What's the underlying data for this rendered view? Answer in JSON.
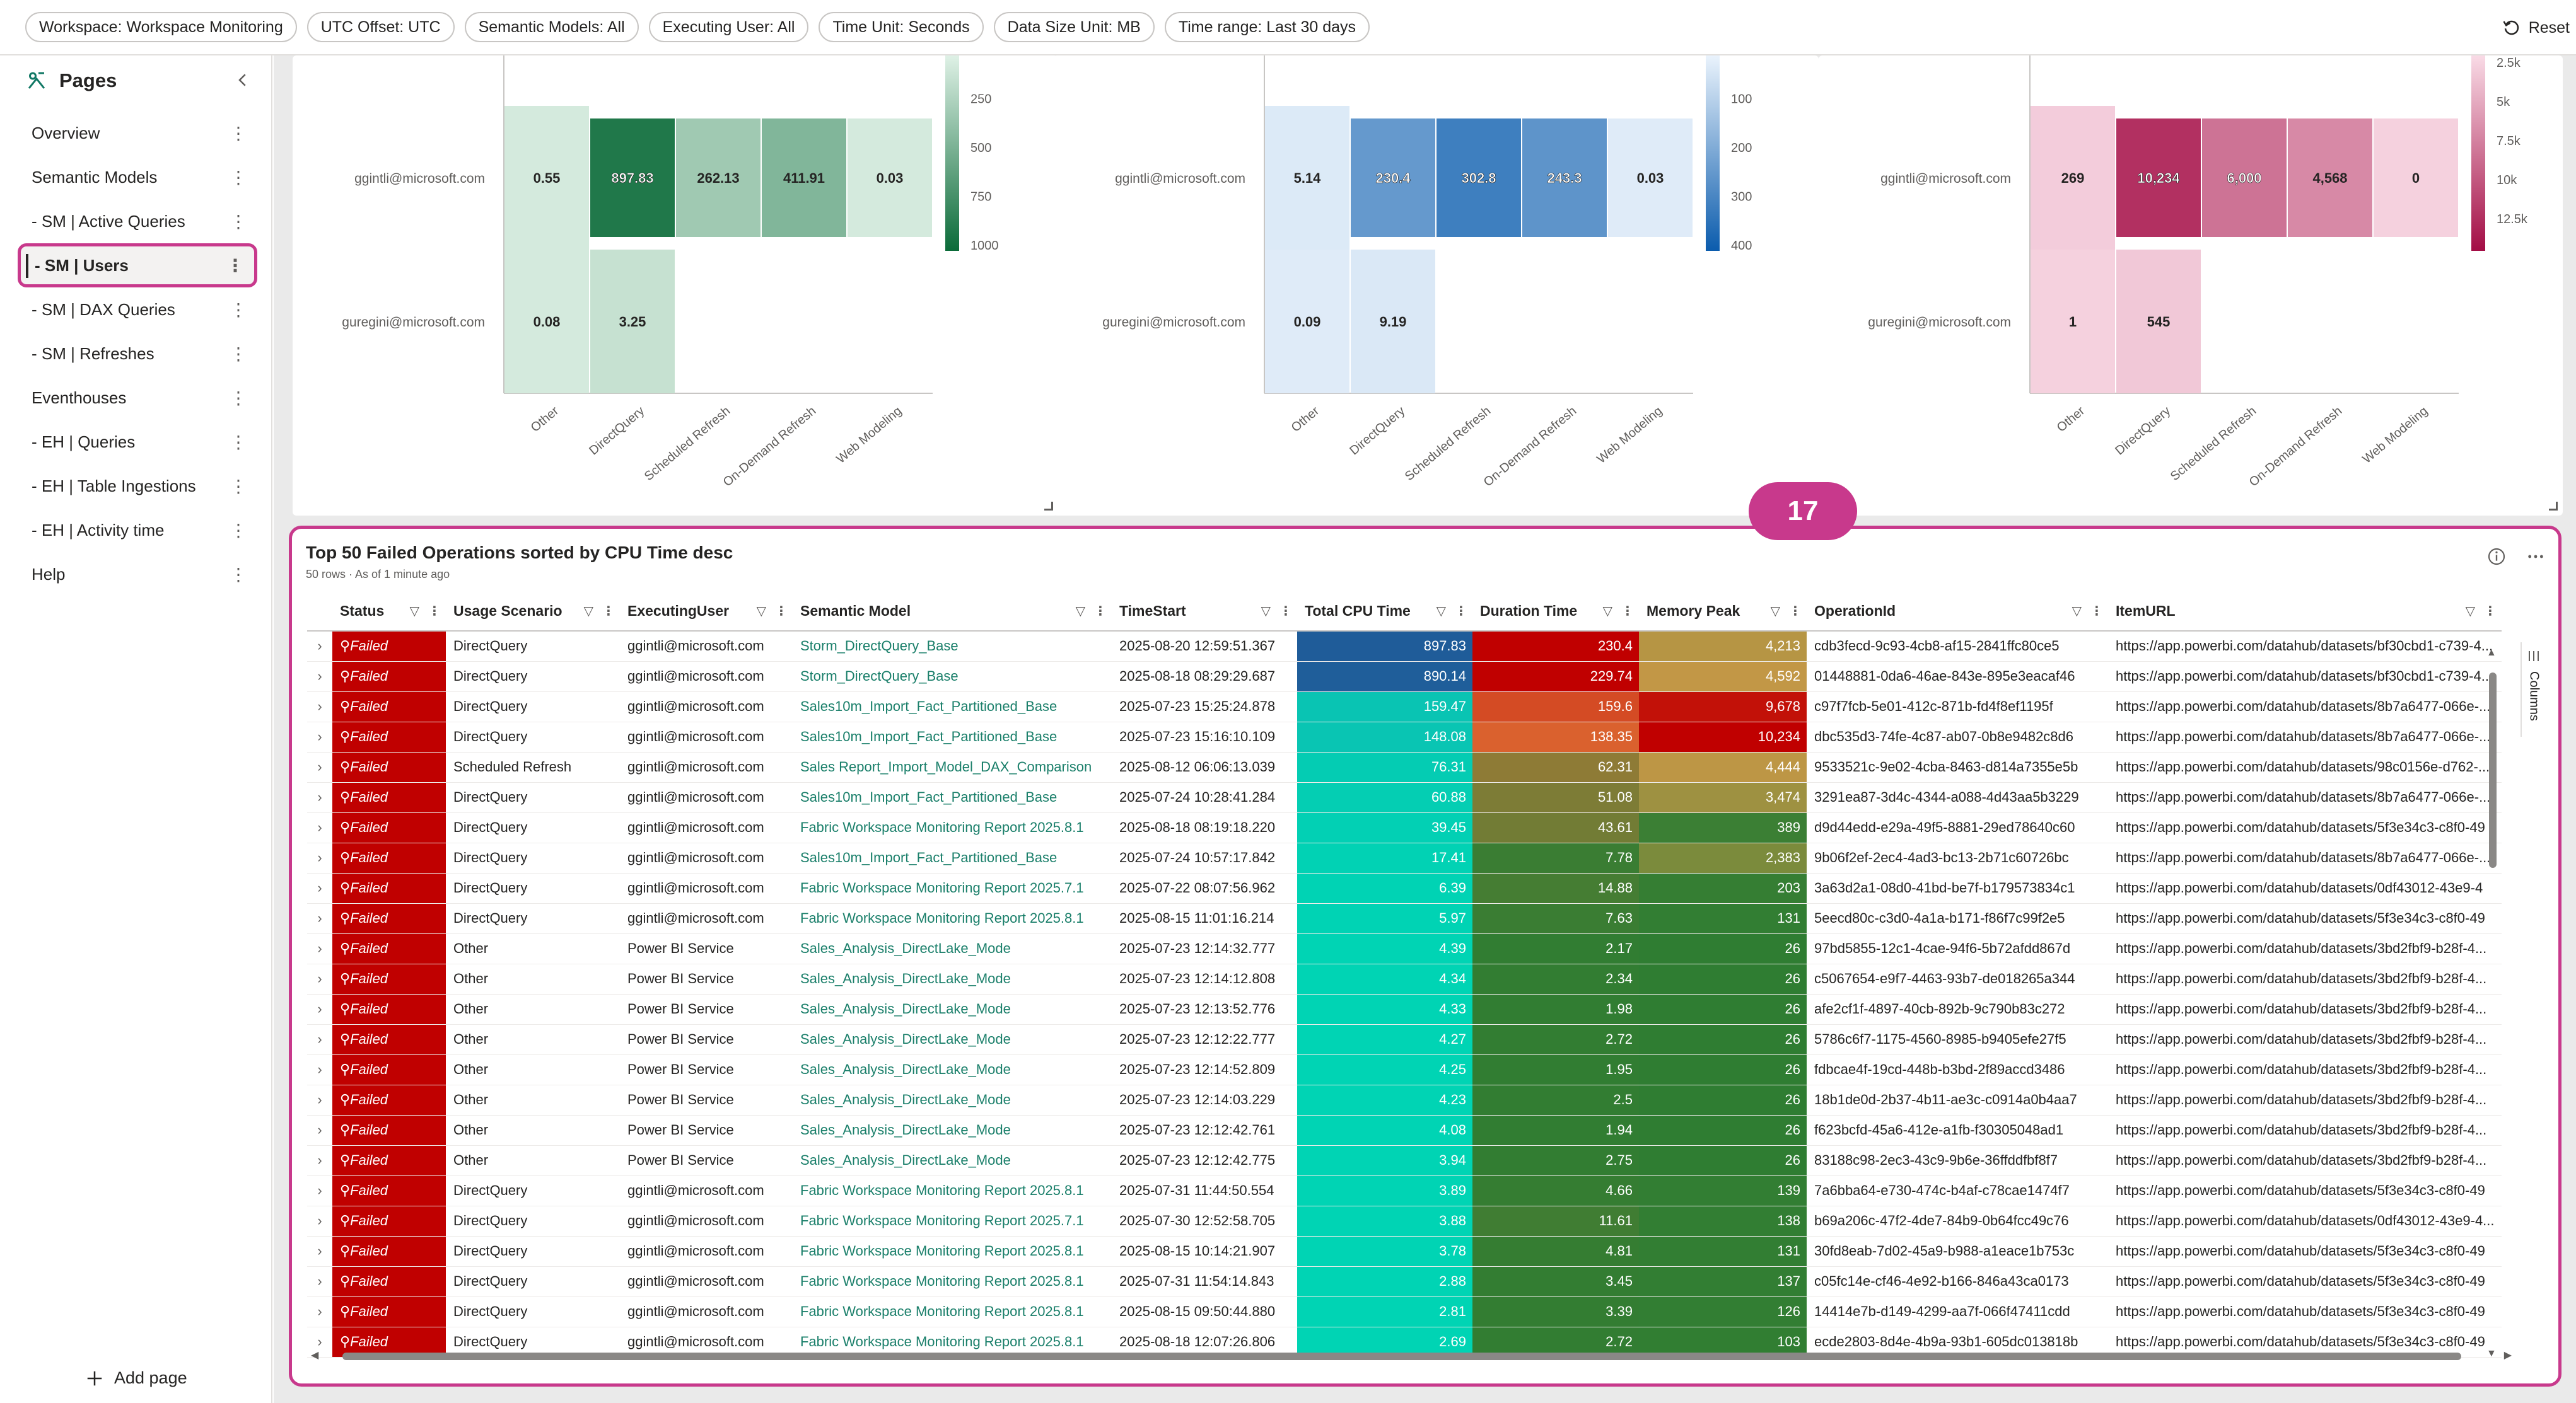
{
  "filters": [
    "Workspace: Workspace Monitoring",
    "UTC Offset: UTC",
    "Semantic Models: All",
    "Executing User: All",
    "Time Unit: Seconds",
    "Data Size Unit: MB",
    "Time range: Last 30 days"
  ],
  "reset_label": "Reset",
  "pages_pane": {
    "title": "Pages",
    "items": [
      {
        "label": "Overview"
      },
      {
        "label": "Semantic Models"
      },
      {
        "label": "- SM | Active Queries"
      },
      {
        "label": "- SM | Users",
        "active": true
      },
      {
        "label": "- SM | DAX Queries"
      },
      {
        "label": "- SM | Refreshes"
      },
      {
        "label": "Eventhouses"
      },
      {
        "label": "- EH | Queries"
      },
      {
        "label": "- EH | Table Ingestions"
      },
      {
        "label": "- EH | Activity time"
      },
      {
        "label": "Help"
      }
    ],
    "add_page_label": "Add page"
  },
  "heatmaps": [
    {
      "rows": [
        "ggintli@microsoft.com",
        "guregini@microsoft.com"
      ],
      "cols": [
        "Other",
        "DirectQuery",
        "Scheduled Refresh",
        "On-Demand Refresh",
        "Web Modeling"
      ],
      "cells": [
        [
          "0.55",
          "897.83",
          "262.13",
          "411.91",
          "0.03"
        ],
        [
          "0.08",
          "3.25",
          "",
          "",
          ""
        ]
      ],
      "values": [
        [
          0.55,
          897.83,
          262.13,
          411.91,
          0.03
        ],
        [
          0.08,
          3.25,
          null,
          null,
          null
        ]
      ],
      "scale_max": 1000,
      "legend_ticks": [
        "250",
        "500",
        "750",
        "1000"
      ],
      "palette": {
        "low": "#dff1e6",
        "high": "#0b6b39"
      }
    },
    {
      "rows": [
        "ggintli@microsoft.com",
        "guregini@microsoft.com"
      ],
      "cols": [
        "Other",
        "DirectQuery",
        "Scheduled Refresh",
        "On-Demand Refresh",
        "Web Modeling"
      ],
      "cells": [
        [
          "5.14",
          "230.4",
          "302.8",
          "243.3",
          "0.03"
        ],
        [
          "0.09",
          "9.19",
          "",
          "",
          ""
        ]
      ],
      "values": [
        [
          5.14,
          230.4,
          302.8,
          243.3,
          0.03
        ],
        [
          0.09,
          9.19,
          null,
          null,
          null
        ]
      ],
      "scale_max": 400,
      "legend_ticks": [
        "100",
        "200",
        "300",
        "400"
      ],
      "palette": {
        "low": "#eaf3fc",
        "high": "#0b5cad"
      }
    },
    {
      "rows": [
        "ggintli@microsoft.com",
        "guregini@microsoft.com"
      ],
      "cols": [
        "Other",
        "DirectQuery",
        "Scheduled Refresh",
        "On-Demand Refresh",
        "Web Modeling"
      ],
      "cells": [
        [
          "269",
          "10,234",
          "6,000",
          "4,568",
          "0"
        ],
        [
          "1",
          "545",
          "",
          "",
          ""
        ]
      ],
      "values": [
        [
          269,
          10234,
          6000,
          4568,
          0
        ],
        [
          1,
          545,
          null,
          null,
          null
        ]
      ],
      "scale_max": 12500,
      "legend_ticks": [
        "2.5k",
        "5k",
        "7.5k",
        "10k",
        "12.5k"
      ],
      "palette": {
        "low": "#f9dbe6",
        "high": "#a30d45"
      }
    }
  ],
  "table": {
    "badge": "17",
    "title": "Top 50 Failed Operations sorted by CPU Time desc",
    "subtitle": "50 rows · As of 1 minute ago",
    "columns_tab_label": "Columns",
    "headers": [
      "Status",
      "Usage Scenario",
      "ExecutingUser",
      "Semantic Model",
      "TimeStart",
      "Total CPU Time",
      "Duration Time",
      "Memory Peak",
      "OperationId",
      "ItemURL"
    ],
    "rows": [
      [
        "Failed",
        "DirectQuery",
        "ggintli@microsoft.com",
        "Storm_DirectQuery_Base",
        "2025-08-20 12:59:51.367",
        "897.83",
        "230.4",
        "4,213",
        "cdb3fecd-9c93-4cb8-af15-2841ffc80ce5",
        "https://app.powerbi.com/datahub/datasets/bf30cbd1-c739-4..."
      ],
      [
        "Failed",
        "DirectQuery",
        "ggintli@microsoft.com",
        "Storm_DirectQuery_Base",
        "2025-08-18 08:29:29.687",
        "890.14",
        "229.74",
        "4,592",
        "01448881-0da6-46ae-843e-895e3eacaf46",
        "https://app.powerbi.com/datahub/datasets/bf30cbd1-c739-4..."
      ],
      [
        "Failed",
        "DirectQuery",
        "ggintli@microsoft.com",
        "Sales10m_Import_Fact_Partitioned_Base",
        "2025-07-23 15:25:24.878",
        "159.47",
        "159.6",
        "9,678",
        "c97f7fcb-5e01-412c-871b-fd4f8ef1195f",
        "https://app.powerbi.com/datahub/datasets/8b7a6477-066e-..."
      ],
      [
        "Failed",
        "DirectQuery",
        "ggintli@microsoft.com",
        "Sales10m_Import_Fact_Partitioned_Base",
        "2025-07-23 15:16:10.109",
        "148.08",
        "138.35",
        "10,234",
        "dbc535d3-74fe-4c87-ab07-0b8e9482c8d6",
        "https://app.powerbi.com/datahub/datasets/8b7a6477-066e-..."
      ],
      [
        "Failed",
        "Scheduled Refresh",
        "ggintli@microsoft.com",
        "Sales Report_Import_Model_DAX_Comparison",
        "2025-08-12 06:06:13.039",
        "76.31",
        "62.31",
        "4,444",
        "9533521c-9e02-4cba-8463-d814a7355e5b",
        "https://app.powerbi.com/datahub/datasets/98c0156e-d762-..."
      ],
      [
        "Failed",
        "DirectQuery",
        "ggintli@microsoft.com",
        "Sales10m_Import_Fact_Partitioned_Base",
        "2025-07-24 10:28:41.284",
        "60.88",
        "51.08",
        "3,474",
        "3291ea87-3d4c-4344-a088-4d43aa5b3229",
        "https://app.powerbi.com/datahub/datasets/8b7a6477-066e-..."
      ],
      [
        "Failed",
        "DirectQuery",
        "ggintli@microsoft.com",
        "Fabric Workspace Monitoring Report 2025.8.1",
        "2025-08-18 08:19:18.220",
        "39.45",
        "43.61",
        "389",
        "d9d44edd-e29a-49f5-8881-29ed78640c60",
        "https://app.powerbi.com/datahub/datasets/5f3e34c3-c8f0-49"
      ],
      [
        "Failed",
        "DirectQuery",
        "ggintli@microsoft.com",
        "Sales10m_Import_Fact_Partitioned_Base",
        "2025-07-24 10:57:17.842",
        "17.41",
        "7.78",
        "2,383",
        "9b06f2ef-2ec4-4ad3-bc13-2b71c60726bc",
        "https://app.powerbi.com/datahub/datasets/8b7a6477-066e-..."
      ],
      [
        "Failed",
        "DirectQuery",
        "ggintli@microsoft.com",
        "Fabric Workspace Monitoring Report 2025.7.1",
        "2025-07-22 08:07:56.962",
        "6.39",
        "14.88",
        "203",
        "3a63d2a1-08d0-41bd-be7f-b179573834c1",
        "https://app.powerbi.com/datahub/datasets/0df43012-43e9-4"
      ],
      [
        "Failed",
        "DirectQuery",
        "ggintli@microsoft.com",
        "Fabric Workspace Monitoring Report 2025.8.1",
        "2025-08-15 11:01:16.214",
        "5.97",
        "7.63",
        "131",
        "5eecd80c-c3d0-4a1a-b171-f86f7c99f2e5",
        "https://app.powerbi.com/datahub/datasets/5f3e34c3-c8f0-49"
      ],
      [
        "Failed",
        "Other",
        "Power BI Service",
        "Sales_Analysis_DirectLake_Mode",
        "2025-07-23 12:14:32.777",
        "4.39",
        "2.17",
        "26",
        "97bd5855-12c1-4cae-94f6-5b72afdd867d",
        "https://app.powerbi.com/datahub/datasets/3bd2fbf9-b28f-4..."
      ],
      [
        "Failed",
        "Other",
        "Power BI Service",
        "Sales_Analysis_DirectLake_Mode",
        "2025-07-23 12:14:12.808",
        "4.34",
        "2.34",
        "26",
        "c5067654-e9f7-4463-93b7-de018265a344",
        "https://app.powerbi.com/datahub/datasets/3bd2fbf9-b28f-4..."
      ],
      [
        "Failed",
        "Other",
        "Power BI Service",
        "Sales_Analysis_DirectLake_Mode",
        "2025-07-23 12:13:52.776",
        "4.33",
        "1.98",
        "26",
        "afe2cf1f-4897-40cb-892b-9c790b83c272",
        "https://app.powerbi.com/datahub/datasets/3bd2fbf9-b28f-4..."
      ],
      [
        "Failed",
        "Other",
        "Power BI Service",
        "Sales_Analysis_DirectLake_Mode",
        "2025-07-23 12:12:22.777",
        "4.27",
        "2.72",
        "26",
        "5786c6f7-1175-4560-8985-b9405efe27f5",
        "https://app.powerbi.com/datahub/datasets/3bd2fbf9-b28f-4..."
      ],
      [
        "Failed",
        "Other",
        "Power BI Service",
        "Sales_Analysis_DirectLake_Mode",
        "2025-07-23 12:14:52.809",
        "4.25",
        "1.95",
        "26",
        "fdbcae4f-19cd-448b-b3bd-2f89accd3486",
        "https://app.powerbi.com/datahub/datasets/3bd2fbf9-b28f-4..."
      ],
      [
        "Failed",
        "Other",
        "Power BI Service",
        "Sales_Analysis_DirectLake_Mode",
        "2025-07-23 12:14:03.229",
        "4.23",
        "2.5",
        "26",
        "18b1de0d-2b37-4b11-ae3c-c0914a0b4aa7",
        "https://app.powerbi.com/datahub/datasets/3bd2fbf9-b28f-4..."
      ],
      [
        "Failed",
        "Other",
        "Power BI Service",
        "Sales_Analysis_DirectLake_Mode",
        "2025-07-23 12:12:42.761",
        "4.08",
        "1.94",
        "26",
        "f623bcfd-45a6-412e-a1fb-f30305048ad1",
        "https://app.powerbi.com/datahub/datasets/3bd2fbf9-b28f-4..."
      ],
      [
        "Failed",
        "Other",
        "Power BI Service",
        "Sales_Analysis_DirectLake_Mode",
        "2025-07-23 12:12:42.775",
        "3.94",
        "2.75",
        "26",
        "83188c98-2ec3-43c9-9b6e-36ffddfbf8f7",
        "https://app.powerbi.com/datahub/datasets/3bd2fbf9-b28f-4..."
      ],
      [
        "Failed",
        "DirectQuery",
        "ggintli@microsoft.com",
        "Fabric Workspace Monitoring Report 2025.8.1",
        "2025-07-31 11:44:50.554",
        "3.89",
        "4.66",
        "139",
        "7a6bba64-e730-474c-b4af-c78cae1474f7",
        "https://app.powerbi.com/datahub/datasets/5f3e34c3-c8f0-49"
      ],
      [
        "Failed",
        "DirectQuery",
        "ggintli@microsoft.com",
        "Fabric Workspace Monitoring Report 2025.7.1",
        "2025-07-30 12:52:58.705",
        "3.88",
        "11.61",
        "138",
        "b69a206c-47f2-4de7-84b9-0b64fcc49c76",
        "https://app.powerbi.com/datahub/datasets/0df43012-43e9-4..."
      ],
      [
        "Failed",
        "DirectQuery",
        "ggintli@microsoft.com",
        "Fabric Workspace Monitoring Report 2025.8.1",
        "2025-08-15 10:14:21.907",
        "3.78",
        "4.81",
        "131",
        "30fd8eab-7d02-45a9-b988-a1eace1b753c",
        "https://app.powerbi.com/datahub/datasets/5f3e34c3-c8f0-49"
      ],
      [
        "Failed",
        "DirectQuery",
        "ggintli@microsoft.com",
        "Fabric Workspace Monitoring Report 2025.8.1",
        "2025-07-31 11:54:14.843",
        "2.88",
        "3.45",
        "137",
        "c05fc14e-cf46-4e92-b166-846a43ca0173",
        "https://app.powerbi.com/datahub/datasets/5f3e34c3-c8f0-49"
      ],
      [
        "Failed",
        "DirectQuery",
        "ggintli@microsoft.com",
        "Fabric Workspace Monitoring Report 2025.8.1",
        "2025-08-15 09:50:44.880",
        "2.81",
        "3.39",
        "126",
        "14414e7b-d149-4299-aa7f-066f47411cdd",
        "https://app.powerbi.com/datahub/datasets/5f3e34c3-c8f0-49"
      ],
      [
        "Failed",
        "DirectQuery",
        "ggintli@microsoft.com",
        "Fabric Workspace Monitoring Report 2025.8.1",
        "2025-08-18 12:07:26.806",
        "2.69",
        "2.72",
        "103",
        "ecde2803-8d4e-4b9a-93b1-605dc013818b",
        "https://app.powerbi.com/datahub/datasets/5f3e34c3-c8f0-49"
      ]
    ],
    "colors": {
      "status_failed": "#c00000",
      "cpu_high": "#1f5c99",
      "cpu_mid": "#1aa7b0",
      "cpu_low": "#00d4b4",
      "dur_high": "#c00000",
      "dur_mid": "#e07a3a",
      "dur_low": "#2e7d32",
      "mem_high": "#c00000",
      "mem_mid": "#d39a48",
      "mem_low": "#2e7d32",
      "link": "#1a7f6a"
    }
  }
}
